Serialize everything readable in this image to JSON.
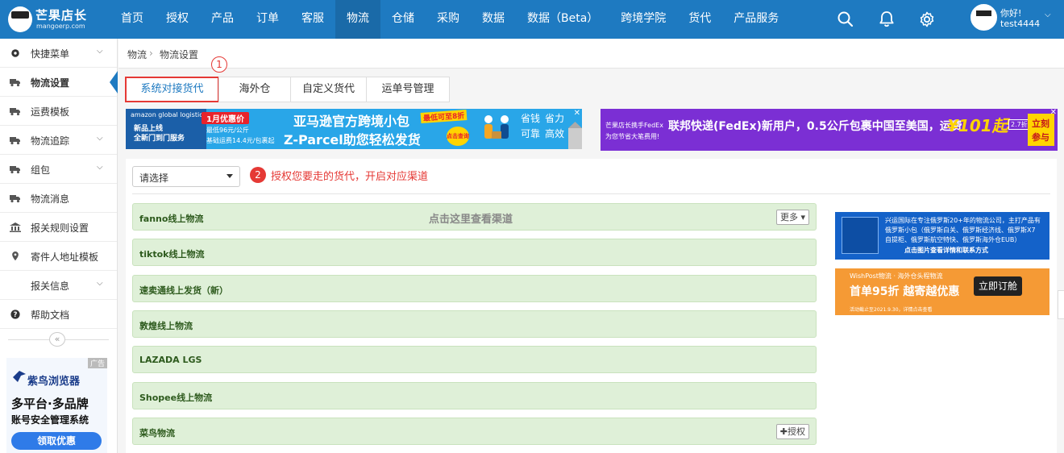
{
  "header": {
    "logo_title": "芒果店长",
    "logo_sub": "mangoerp.com",
    "nav": [
      "首页",
      "授权",
      "产品",
      "订单",
      "客服",
      "物流",
      "仓储",
      "采购",
      "数据",
      "数据（Beta）",
      "跨境学院",
      "货代",
      "产品服务"
    ],
    "active_nav": "物流",
    "user_greeting": "你好!",
    "user_name": "test4444"
  },
  "sidebar": {
    "items": [
      {
        "label": "快捷菜单",
        "icon": "gear-icon",
        "arrow": true
      },
      {
        "label": "物流设置",
        "icon": "truck-icon",
        "arrow": false,
        "active": true
      },
      {
        "label": "运费模板",
        "icon": "truck-icon",
        "arrow": false
      },
      {
        "label": "物流追踪",
        "icon": "truck-icon",
        "arrow": true
      },
      {
        "label": "组包",
        "icon": "truck-icon",
        "arrow": true
      },
      {
        "label": "物流消息",
        "icon": "truck-icon",
        "arrow": false
      },
      {
        "label": "报关规则设置",
        "icon": "bank-icon",
        "arrow": false
      },
      {
        "label": "寄件人地址模板",
        "icon": "pin-icon",
        "arrow": false
      },
      {
        "label": "报关信息",
        "icon": "",
        "arrow": true
      },
      {
        "label": "帮助文档",
        "icon": "question-icon",
        "arrow": false
      }
    ],
    "collapse_glyph": "«",
    "ad": {
      "tag": "广告",
      "brand": "紫鸟浏览器",
      "line1": "多平台·多品牌",
      "line2": "账号安全管理系统",
      "cta": "领取优惠"
    }
  },
  "breadcrumb": {
    "root": "物流",
    "sep": "›",
    "current": "物流设置"
  },
  "tabs": [
    "系统对接货代",
    "海外仓",
    "自定义货代",
    "运单号管理"
  ],
  "active_tab": "系统对接货代",
  "badges": {
    "one": "1",
    "two": "2"
  },
  "banner1": {
    "brand": "amazon global logistics",
    "tag": "1月优惠价",
    "left1": "新品上线",
    "left2": "全新门到门服务",
    "price1": "最低96元/公斤",
    "price2": "基础运费14.4元/包裹起",
    "head": "亚马逊官方跨境小包",
    "sub": "Z-Parcel助您轻松发货",
    "promo": "最低可至8折",
    "cta": "点击查询",
    "w1": "省钱",
    "w2": "省力",
    "w3": "可靠",
    "w4": "高效"
  },
  "banner2": {
    "pre": "芒果店长携手FedEx",
    "pre2": "为您节省大笔费用!",
    "head": "联邦快递(FedEx)新用户，0.5公斤包裹中国至美国，运费",
    "price": "¥101起",
    "unit": "2.7折",
    "cta1": "立刻",
    "cta2": "参与"
  },
  "filter": {
    "select_value": "请选择",
    "hint": "授权您要走的货代，开启对应渠道"
  },
  "rows": [
    {
      "label": "fanno线上物流",
      "center": "点击这里查看渠道",
      "button": "更多 ▾"
    },
    {
      "label": "tiktok线上物流",
      "center": "",
      "button": ""
    },
    {
      "label": "速卖通线上发货（新）",
      "center": "",
      "button": ""
    },
    {
      "label": "敦煌线上物流",
      "center": "",
      "button": ""
    },
    {
      "label": "LAZADA LGS",
      "center": "",
      "button": ""
    },
    {
      "label": "Shopee线上物流",
      "center": "",
      "button": ""
    },
    {
      "label": "菜鸟物流",
      "center": "",
      "button": "✚授权"
    }
  ],
  "side_ad1": {
    "text1": "兴运国际在专注俄罗斯20+年的物流公司，主打产品有",
    "text2": "俄罗斯小包（俄罗斯白关、俄罗斯经济线、俄罗斯X7",
    "text3": "自提柜、俄罗斯航空特快、俄罗斯海外仓EUB）",
    "cta": "点击图片查看详情和联系方式"
  },
  "side_ad2": {
    "brand": "WishPost物流 · 海外仓头程物流",
    "head": "首单95折 越寄越优惠",
    "cta": "立即订舱",
    "foot": "活动截止至2021.9.30，详情点击查看"
  },
  "colors": {
    "primary": "#1e7ac1",
    "active_nav": "#1a6aa8",
    "red": "#e53935",
    "row_bg": "#dff0d8"
  }
}
